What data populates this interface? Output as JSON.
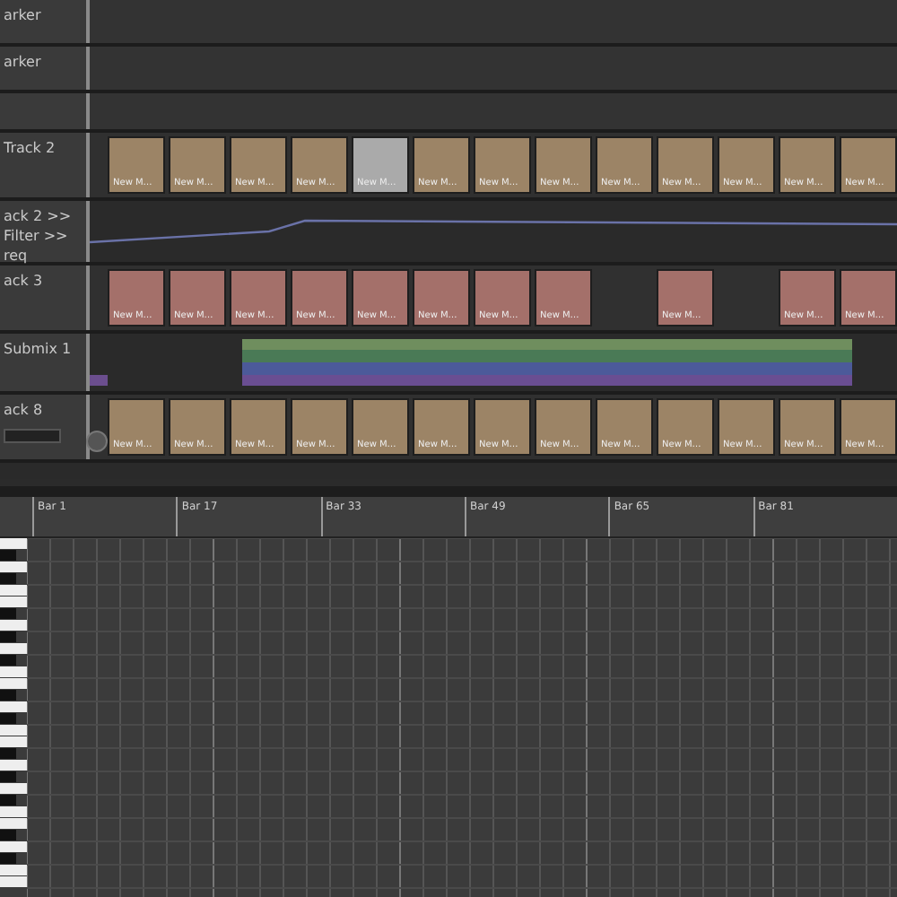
{
  "tracks": [
    {
      "kind": "marker",
      "name": "arker"
    },
    {
      "kind": "marker",
      "name": "arker"
    },
    {
      "kind": "spacer"
    },
    {
      "kind": "audio",
      "name": "Track 2",
      "color": "#9c8466",
      "clips": [
        {
          "kind": "clip",
          "label": "New M…",
          "selected": false
        },
        {
          "kind": "clip",
          "label": "New M…",
          "selected": false
        },
        {
          "kind": "clip",
          "label": "New M…",
          "selected": false
        },
        {
          "kind": "clip",
          "label": "New M…",
          "selected": false
        },
        {
          "kind": "clip",
          "label": "New M…",
          "selected": true
        },
        {
          "kind": "clip",
          "label": "New M…",
          "selected": false
        },
        {
          "kind": "clip",
          "label": "New M…",
          "selected": false
        },
        {
          "kind": "clip",
          "label": "New M…",
          "selected": false
        },
        {
          "kind": "clip",
          "label": "New M…",
          "selected": false
        },
        {
          "kind": "clip",
          "label": "New M…",
          "selected": false
        },
        {
          "kind": "clip",
          "label": "New M…",
          "selected": false
        },
        {
          "kind": "clip",
          "label": "New M…",
          "selected": false
        },
        {
          "kind": "clip",
          "label": "New M…",
          "selected": false
        }
      ]
    },
    {
      "kind": "automation",
      "lines": [
        "ack 2 >>",
        "Filter >>",
        "req"
      ]
    },
    {
      "kind": "audio",
      "name": "ack 3",
      "color": "#a4706a",
      "clips": [
        {
          "kind": "clip",
          "label": "New M…",
          "selected": false
        },
        {
          "kind": "clip",
          "label": "New M…",
          "selected": false
        },
        {
          "kind": "clip",
          "label": "New M…",
          "selected": false
        },
        {
          "kind": "clip",
          "label": "New M…",
          "selected": false
        },
        {
          "kind": "clip",
          "label": "New M…",
          "selected": false
        },
        {
          "kind": "clip",
          "label": "New M…",
          "selected": false
        },
        {
          "kind": "clip",
          "label": "New M…",
          "selected": false
        },
        {
          "kind": "clip",
          "label": "New M…",
          "selected": false
        },
        {
          "kind": "empty"
        },
        {
          "kind": "clip",
          "label": "New M…",
          "selected": false
        },
        {
          "kind": "empty"
        },
        {
          "kind": "clip",
          "label": "New M…",
          "selected": false
        },
        {
          "kind": "clip",
          "label": "New M…",
          "selected": false
        }
      ]
    },
    {
      "kind": "bus",
      "name": "Submix 1"
    },
    {
      "kind": "audio",
      "name": "ack 8",
      "color": "#9c8466",
      "control": true,
      "clips": [
        {
          "kind": "clip",
          "label": "New M…",
          "selected": false
        },
        {
          "kind": "clip",
          "label": "New M…",
          "selected": false
        },
        {
          "kind": "clip",
          "label": "New M…",
          "selected": false
        },
        {
          "kind": "clip",
          "label": "New M…",
          "selected": false
        },
        {
          "kind": "clip",
          "label": "New M…",
          "selected": false
        },
        {
          "kind": "clip",
          "label": "New M…",
          "selected": false
        },
        {
          "kind": "clip",
          "label": "New M…",
          "selected": false
        },
        {
          "kind": "clip",
          "label": "New M…",
          "selected": false
        },
        {
          "kind": "clip",
          "label": "New M…",
          "selected": false
        },
        {
          "kind": "clip",
          "label": "New M…",
          "selected": false
        },
        {
          "kind": "clip",
          "label": "New M…",
          "selected": false
        },
        {
          "kind": "clip",
          "label": "New M…",
          "selected": false
        },
        {
          "kind": "clip",
          "label": "New M…",
          "selected": false
        }
      ]
    }
  ],
  "ruler": [
    "Bar 1",
    "Bar 17",
    "Bar 33",
    "Bar 49",
    "Bar 65",
    "Bar 81"
  ]
}
